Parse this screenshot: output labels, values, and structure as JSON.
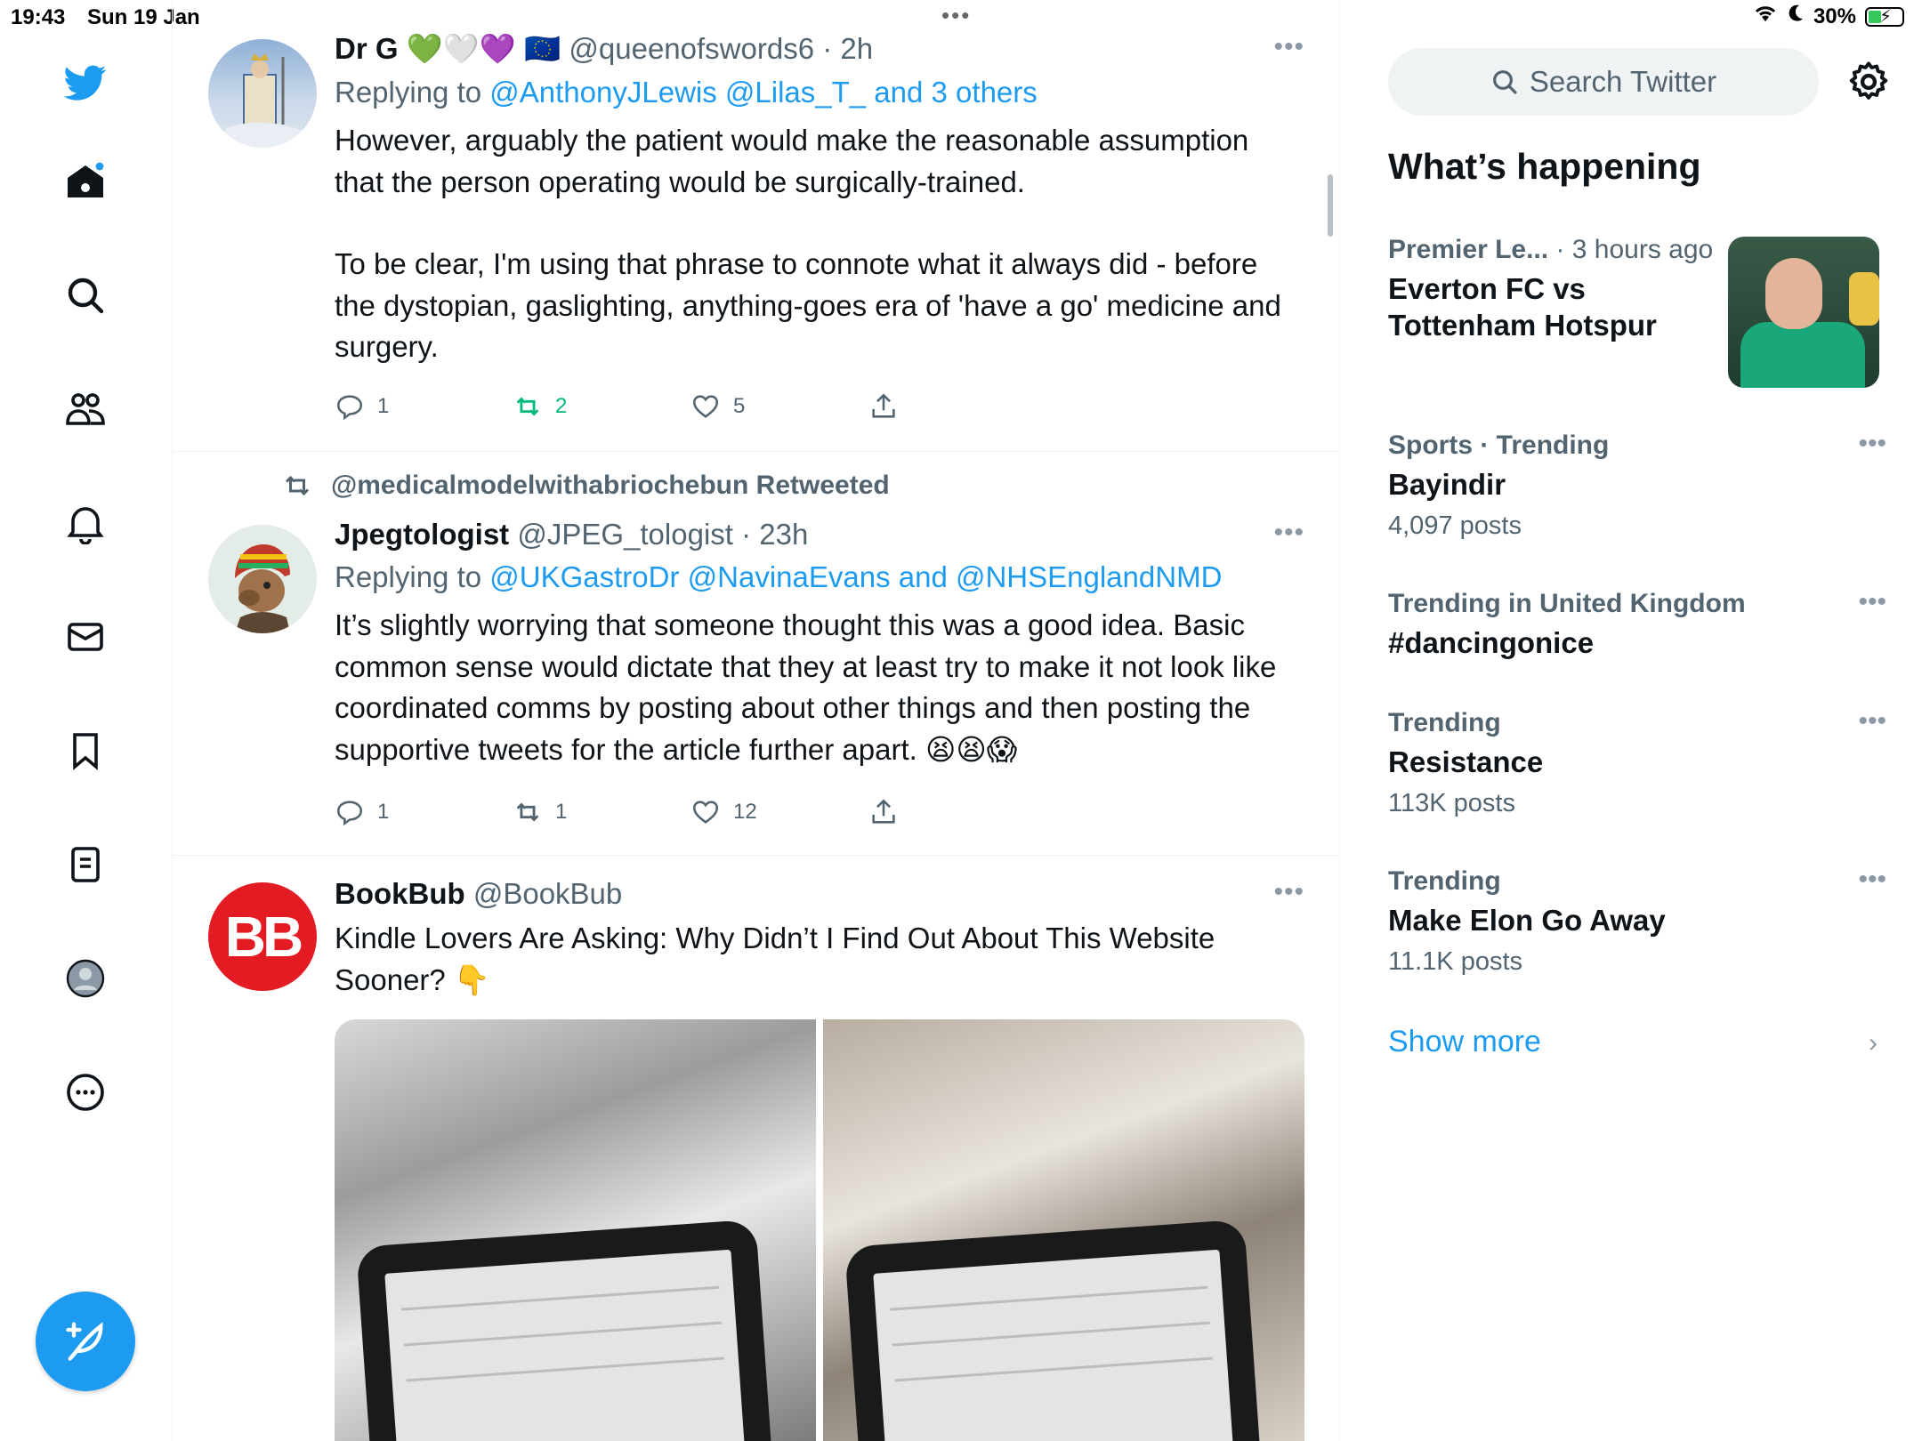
{
  "status_bar": {
    "time": "19:43",
    "date": "Sun 19 Jan",
    "battery": "30%"
  },
  "nav": {
    "items": [
      "twitter-logo",
      "home-icon",
      "search-icon",
      "communities-icon",
      "notifications-icon",
      "messages-icon",
      "bookmarks-icon",
      "lists-icon",
      "profile-icon",
      "more-icon"
    ],
    "compose_label": "Tweet"
  },
  "tweets": [
    {
      "name": "Dr G",
      "name_suffix": "💚🤍💜 🇪🇺",
      "handle": "@queenofswords6",
      "time": "· 2h",
      "replying_prefix": "Replying to ",
      "replying_to": "@AnthonyJLewis @Lilas_T_ and 3 others",
      "text_p1": "However, arguably the patient would make the reasonable assumption that the person operating would be surgically-trained.",
      "text_p2": "To be clear, I'm using that phrase to connote what it always did - before the dystopian, gaslighting, anything-goes era of 'have a go' medicine and surgery.",
      "replies": "1",
      "retweets": "2",
      "likes": "5"
    },
    {
      "retweeted_by": "@medicalmodelwithabriochebun Retweeted",
      "name": "Jpegtologist",
      "handle": "@JPEG_tologist",
      "time": "· 23h",
      "replying_prefix": "Replying to ",
      "replying_to": "@UKGastroDr @NavinaEvans and @NHSEnglandNMD",
      "text": "It’s slightly worrying that someone thought this was a good idea. Basic common sense would dictate that they at least try to make it not look like coordinated comms by posting about other things and then posting the supportive tweets for the article further apart. 😫😫😱",
      "replies": "1",
      "retweets": "1",
      "likes": "12"
    },
    {
      "name": "BookBub",
      "handle": "@BookBub",
      "avatar_text": "BB",
      "text": "Kindle Lovers Are Asking: Why Didn’t I Find Out About This Website Sooner? 👇"
    }
  ],
  "sidebar": {
    "search_placeholder": "Search Twitter",
    "title": "What’s happening",
    "trends": [
      {
        "category": "Premier Le...",
        "meta_suffix": " · 3 hours ago",
        "topic": "Everton FC vs Tottenham Hotspur",
        "count": ""
      },
      {
        "category": "Sports · Trending",
        "meta_suffix": "",
        "topic": "Bayindir",
        "count": "4,097 posts"
      },
      {
        "category": "Trending in United Kingdom",
        "meta_suffix": "",
        "topic": "#dancingonice",
        "count": ""
      },
      {
        "category": "Trending",
        "meta_suffix": "",
        "topic": "Resistance",
        "count": "113K posts"
      },
      {
        "category": "Trending",
        "meta_suffix": "",
        "topic": "Make Elon Go Away",
        "count": "11.1K posts"
      }
    ],
    "show_more": "Show more"
  },
  "colors": {
    "accent": "#1d9bf0",
    "retweet_green": "#00ba7c",
    "text_secondary": "#536471",
    "bookbub_red": "#e31b23"
  }
}
